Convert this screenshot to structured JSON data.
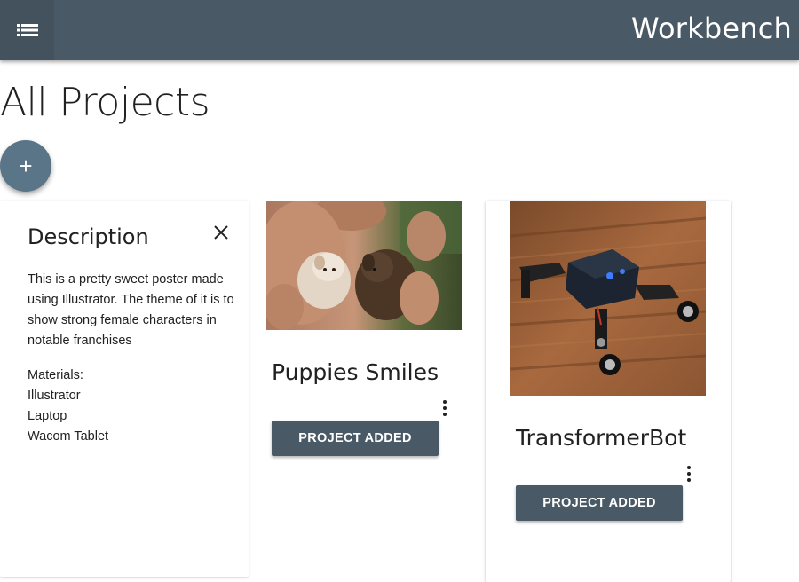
{
  "appbar": {
    "title": "Workbench",
    "menu_icon": "list-menu-icon",
    "background": "#495a66"
  },
  "page": {
    "title": "All Projects",
    "fab_label": "+"
  },
  "description_panel": {
    "title": "Description",
    "close_icon": "close-icon",
    "text": "This is a pretty sweet poster made using Illustrator. The theme of it is to show strong female characters in notable franchises",
    "materials_label": "Materials:",
    "materials": [
      "Illustrator",
      "Laptop",
      "Wacom Tablet"
    ]
  },
  "projects": [
    {
      "title": "Puppies Smiles",
      "image": "photo-two-puppies",
      "button_label": "PROJECT ADDED",
      "more_icon": "more-vert-icon"
    },
    {
      "title": "TransformerBot",
      "image": "photo-robot",
      "button_label": "PROJECT ADDED",
      "more_icon": "more-vert-icon"
    }
  ],
  "colors": {
    "primary": "#495a66",
    "fab": "#5b7588"
  }
}
